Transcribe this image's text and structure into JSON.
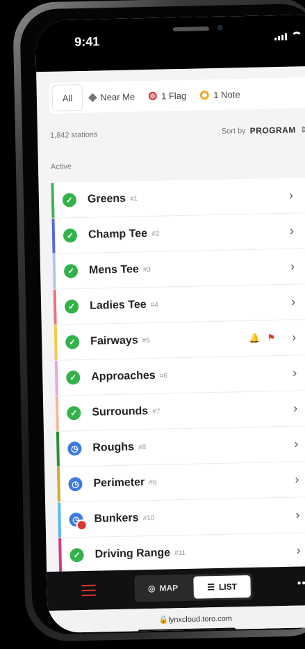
{
  "status_bar": {
    "time": "9:41"
  },
  "filters": [
    {
      "label": "All",
      "icon": "none",
      "active": true
    },
    {
      "label": "Near Me",
      "icon": "location-icon",
      "active": false
    },
    {
      "label": "1 Flag",
      "icon": "flag-dot-icon",
      "active": false
    },
    {
      "label": "1 Note",
      "icon": "note-dot-icon",
      "active": false
    }
  ],
  "summary": {
    "count": "1,842 stations",
    "sort_label": "Sort by",
    "sort_value": "PROGRAM",
    "section": "Active"
  },
  "stations": [
    {
      "name": "Greens",
      "number": "#1",
      "status": "ok",
      "stripe": "#3fb35a"
    },
    {
      "name": "Champ Tee",
      "number": "#2",
      "status": "ok",
      "stripe": "#5868d8"
    },
    {
      "name": "Mens Tee",
      "number": "#3",
      "status": "ok",
      "stripe": "#a9c9ef"
    },
    {
      "name": "Ladies Tee",
      "number": "#4",
      "status": "ok",
      "stripe": "#e9737c"
    },
    {
      "name": "Fairways",
      "number": "#5",
      "status": "ok",
      "stripe": "#f4c94a",
      "alerts": [
        "bell-icon",
        "flag-icon"
      ]
    },
    {
      "name": "Approaches",
      "number": "#6",
      "status": "ok",
      "stripe": "#e9a6cf"
    },
    {
      "name": "Surrounds",
      "number": "#7",
      "status": "ok",
      "stripe": "#f6b69a"
    },
    {
      "name": "Roughs",
      "number": "#8",
      "status": "scheduled",
      "stripe": "#2e8f3a"
    },
    {
      "name": "Perimeter",
      "number": "#9",
      "status": "scheduled",
      "stripe": "#d4a830"
    },
    {
      "name": "Bunkers",
      "number": "#10",
      "status": "scheduled-alert",
      "stripe": "#5ab9ea"
    },
    {
      "name": "Driving Range",
      "number": "#11",
      "status": "ok",
      "stripe": "#d13c8a"
    }
  ],
  "bottom_bar": {
    "map_label": "MAP",
    "list_label": "LIST",
    "active": "LIST"
  },
  "browser": {
    "url": "lynxcloud.toro.com"
  },
  "colors": {
    "ok": "#34b24a",
    "scheduled": "#3d7be0",
    "alert": "#e0362c",
    "note": "#f5a623"
  }
}
